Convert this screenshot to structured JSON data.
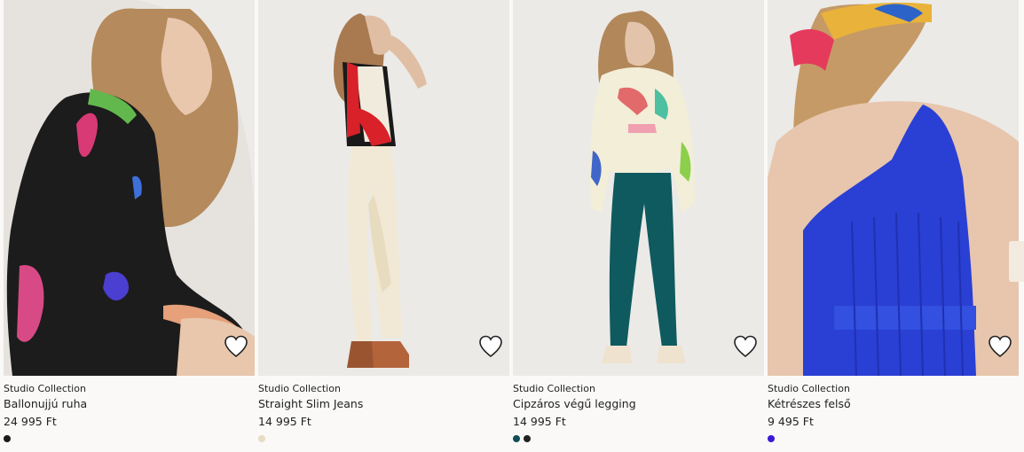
{
  "products": [
    {
      "brand": "Studio Collection",
      "name": "Ballonujjú ruha",
      "price": "24 995 Ft",
      "favorite_icon": "heart-outline-icon",
      "swatches": [
        "#1a1a1a"
      ]
    },
    {
      "brand": "Studio Collection",
      "name": "Straight Slim Jeans",
      "price": "14 995 Ft",
      "favorite_icon": "heart-outline-icon",
      "swatches": [
        "#e5dcc3"
      ]
    },
    {
      "brand": "Studio Collection",
      "name": "Cipzáros végű legging",
      "price": "14 995 Ft",
      "favorite_icon": "heart-outline-icon",
      "swatches": [
        "#0f4e55",
        "#222222"
      ]
    },
    {
      "brand": "Studio Collection",
      "name": "Kétrészes felső",
      "price": "9 495 Ft",
      "favorite_icon": "heart-outline-icon",
      "swatches": [
        "#3a1ad6"
      ]
    }
  ],
  "colors": {
    "background": "#faf9f8",
    "photo_background": "#e9e7e4",
    "text": "#222222"
  }
}
